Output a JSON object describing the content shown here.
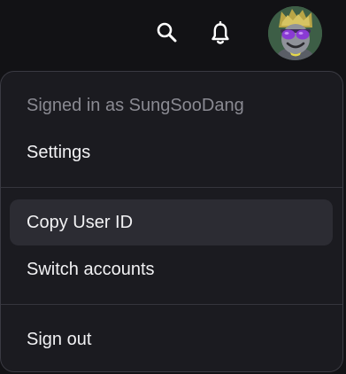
{
  "header": {
    "search_icon": "search-icon",
    "notifications_icon": "bell-icon",
    "avatar_icon": "user-avatar"
  },
  "menu": {
    "signed_in_label": "Signed in as SungSooDang",
    "items": [
      {
        "label": "Settings"
      },
      {
        "label": "Copy User ID"
      },
      {
        "label": "Switch accounts"
      },
      {
        "label": "Sign out"
      }
    ]
  },
  "colors": {
    "background": "#121215",
    "menu_background": "#1b1b20",
    "menu_border": "#3a3a42",
    "hover_background": "#2c2c33",
    "muted_text": "#8a8a92",
    "text": "#f2f2f4"
  }
}
